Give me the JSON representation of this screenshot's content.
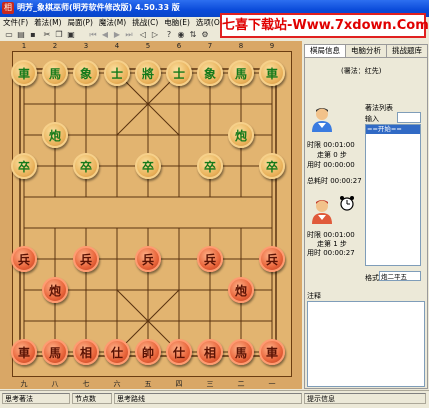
{
  "window": {
    "title": "明芳_象棋巫师(明芳软件修改版) 4.50.33 版",
    "icon_char": "相"
  },
  "banner": {
    "text": "七喜下载站-Www.7xdown.Com"
  },
  "menu": [
    "文件(F)",
    "着法(M)",
    "局面(P)",
    "魔法(M)",
    "挑战(C)",
    "电脑(E)",
    "选项(O)",
    "工"
  ],
  "board": {
    "top_files": [
      "1",
      "2",
      "3",
      "4",
      "5",
      "6",
      "7",
      "8",
      "9"
    ],
    "bottom_files": [
      "九",
      "八",
      "七",
      "六",
      "五",
      "四",
      "三",
      "二",
      "一"
    ],
    "black_pieces": [
      "車",
      "馬",
      "象",
      "士",
      "將",
      "士",
      "象",
      "馬",
      "車",
      "炮",
      "炮",
      "卒",
      "卒",
      "卒",
      "卒",
      "卒"
    ],
    "red_pieces": [
      "兵",
      "兵",
      "兵",
      "兵",
      "兵",
      "炮",
      "炮",
      "車",
      "馬",
      "相",
      "仕",
      "帥",
      "仕",
      "相",
      "馬",
      "車"
    ]
  },
  "panel": {
    "tabs": [
      "棋局信息",
      "电脑分析",
      "挑战题库"
    ],
    "note_label": "(署法：红先)",
    "movelist_label": "著法列表",
    "input_label": "输入",
    "movelist_first": "==开始==",
    "black_time_limit": "时限    00:01:00",
    "black_moves": "走第 0 步",
    "black_used": "用时    00:00:00",
    "total_time": "总耗时 00:00:27",
    "red_time_limit": "时限    00:01:00",
    "red_moves": "走第 1 步",
    "red_used": "用时    00:00:27",
    "format_label": "格式",
    "format_value": "炮二平五",
    "notes_label": "注释"
  },
  "status": {
    "thinking_moves": "思考著法",
    "node_count": "节点数",
    "thinking_route": "思考路线",
    "hint_info": "提示信息"
  }
}
